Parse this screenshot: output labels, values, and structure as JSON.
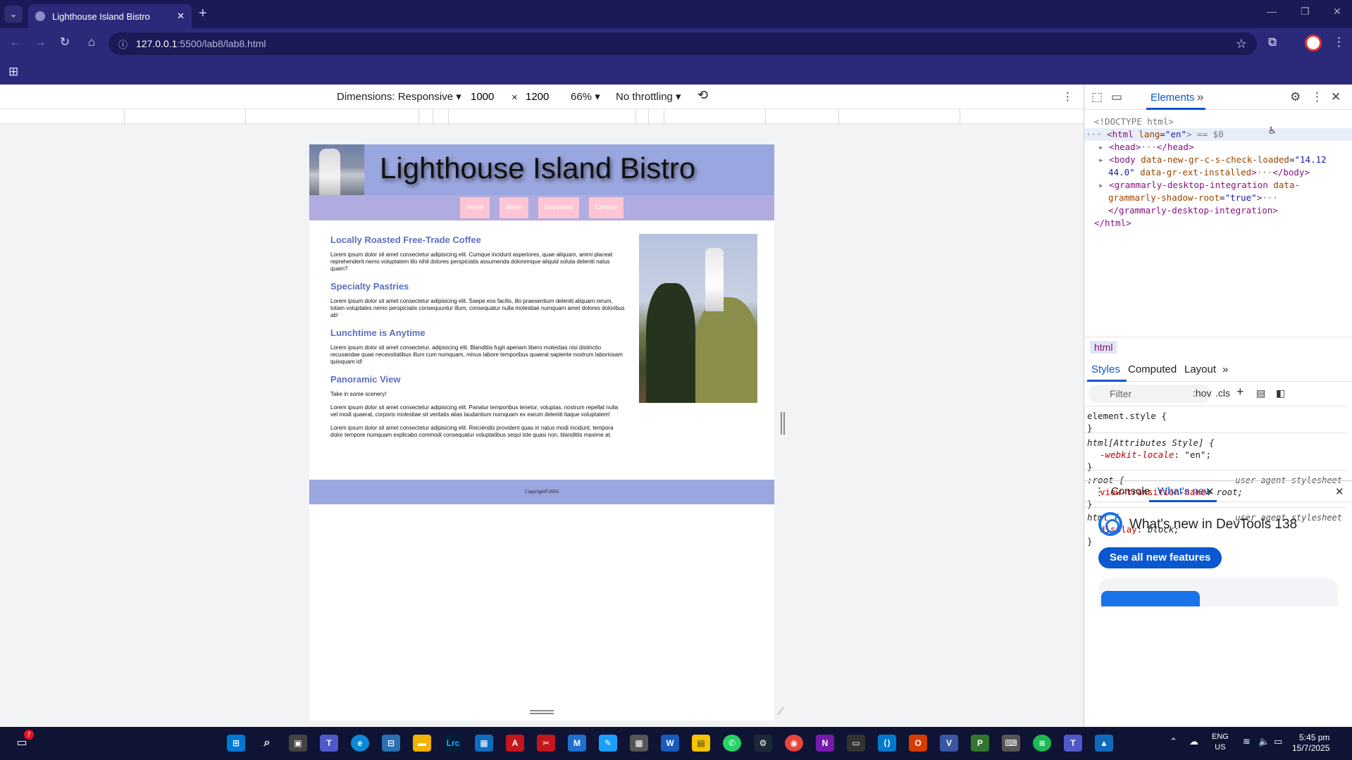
{
  "browser": {
    "tab_title": "Lighthouse Island Bistro",
    "url_host": "127.0.0.1",
    "url_path": ":5500/lab8/lab8.html",
    "new_tab_glyph": "+",
    "tab_close_glyph": "✕"
  },
  "device_toolbar": {
    "dimensions_label": "Dimensions: Responsive",
    "width_value": "1000",
    "times": "×",
    "height_value": "1200",
    "zoom": "66%",
    "throttling": "No throttling"
  },
  "site": {
    "title": "Lighthouse Island Bistro",
    "nav": [
      "Home",
      "Menu",
      "Directions",
      "Contact"
    ],
    "sections": [
      {
        "heading": "Locally Roasted Free-Trade Coffee",
        "paragraphs": [
          "Lorem ipsum dolor sit amet consectetur adipisicing elit. Cumque incidunt asperiores, quae aliquam, animi placeat reprehenderit nemo voluptatem illo nihil dolores perspiciatis assumenda doloremque aliquid soluta deleniti natus quam?"
        ]
      },
      {
        "heading": "Specialty Pastries",
        "paragraphs": [
          "Lorem ipsum dolor sit amet consectetur adipisicing elit. Saepe eos facilis, illo praesentium deleniti aliquam rerum, totam voluptates nemo perspiciatis consequuntur illum, consequatur nulla molestiae numquam amet dolores doloribus ab!"
        ]
      },
      {
        "heading": "Lunchtime is Anytime",
        "paragraphs": [
          "Lorem ipsum dolor sit amet consectetur, adipisicing elit. Blanditiis fugit aperiam libero molestias nisi distinctio recusandae quae necessitatibus illum cum numquam, minus labore temporibus quaerat sapiente nostrum laboriosam quisquam id!"
        ]
      },
      {
        "heading": "Panoramic View",
        "paragraphs": [
          "Take in some scenery!",
          "Lorem ipsum dolor sit amet consectetur adipisicing elit. Pariatur temporibus tenetur, voluptas, nostrum repellat nulla vel modi quaerat, corporis molestiae sit veritatis alias laudantium numquam ex earum deleniti itaque voluptatem!",
          "Lorem ipsum dolor sit amet consectetur adipisicing elit. Reiciendis provident quas in natus modi incidunt, tempora dolor tempore numquam explicabo commodi consequatur voluptatibus sequi iste quasi non, blanditiis maxime at."
        ]
      }
    ],
    "footer": "Copyright©2016"
  },
  "devtools": {
    "active_tab": "Elements",
    "dom": {
      "doctype": "<!DOCTYPE html>",
      "html_open": "<html",
      "html_attr_name": "lang",
      "html_attr_value": "\"en\"",
      "html_eq": "> == $0",
      "head": "<head>",
      "head_close": "</head>",
      "body_open": "<body",
      "body_attr1": "data-new-gr-c-s-check-loaded",
      "body_attr1_value": "\"14.12",
      "body_attr1_value2": "44.0\"",
      "body_attr2": "data-gr-ext-installed",
      "body_close": "</body>",
      "gram_open": "<grammarly-desktop-integration",
      "gram_attr": "data-",
      "gram_attr2": "grammarly-shadow-root",
      "gram_attr2_value": "\"true\"",
      "gram_close": "</grammarly-desktop-integration>",
      "html_close": "</html>",
      "ellipsis": "···"
    },
    "breadcrumb": "html",
    "style_tabs": [
      "Styles",
      "Computed",
      "Layout"
    ],
    "filter_placeholder": "Filter",
    "hov": ":hov",
    "cls": ".cls",
    "rules": [
      {
        "selector": "element.style {",
        "source": "",
        "props": [],
        "close": "}"
      },
      {
        "selector": "html[Attributes Style] {",
        "source": "",
        "props": [
          {
            "name": "-webkit-locale",
            "value": "\"en\";"
          }
        ],
        "close": "}"
      },
      {
        "selector": ":root {",
        "source": "user agent stylesheet",
        "props": [
          {
            "name": "view-transition-name",
            "value": "root;"
          }
        ],
        "close": "}"
      },
      {
        "selector": "html {",
        "source": "user agent stylesheet",
        "props": [
          {
            "name": "display",
            "value": "block;"
          }
        ],
        "close": "}"
      }
    ],
    "drawer_tabs": [
      "Console",
      "What's new"
    ],
    "whats_new_title": "What's new in DevTools 138",
    "whats_new_button": "See all new features"
  },
  "taskbar": {
    "apps": [
      "Start",
      "Search",
      "Task View",
      "Teams",
      "Edge",
      "Store",
      "File Explorer",
      "Lrc",
      "Calendar",
      "Acrobat",
      "Snipping",
      "M365",
      "Steam-Tool",
      "Calculator",
      "Word",
      "Sticky Notes",
      "WhatsApp",
      "Steam",
      "Chrome",
      "OneNote",
      "Terminal",
      "VS Code",
      "Office",
      "Visio",
      "Project",
      "Typing",
      "Spotify",
      "Teams Personal",
      "Photos"
    ],
    "notification_count": "7",
    "language": "ENG",
    "region": "US",
    "time": "5:45 pm",
    "date": "15/7/2025"
  }
}
